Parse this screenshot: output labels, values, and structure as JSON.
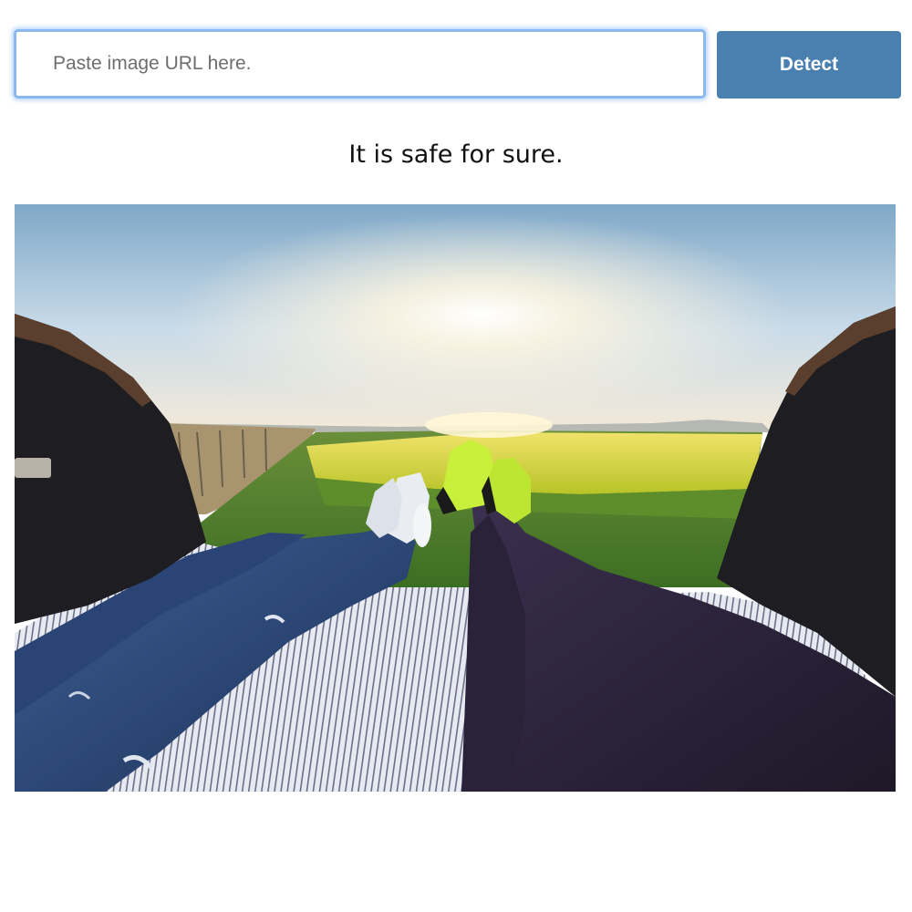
{
  "search": {
    "placeholder": "Paste image URL here.",
    "value": ""
  },
  "detect_button": {
    "label": "Detect"
  },
  "result": {
    "text": "It is safe for sure."
  },
  "photo": {
    "alt": "Two people lying in the open trunk of a car, feet up, facing a sunset over a green and yellow field",
    "colors": {
      "sky_top": "#7fa8c8",
      "sun": "#fff6e0",
      "field_yellow": "#e0e02a",
      "grass": "#4f8a2a",
      "sneaker_green": "#c8f03a",
      "jeans": "#2d4a7a",
      "dark_pants": "#2a2238",
      "car_interior": "#1d1d22"
    }
  },
  "colors": {
    "accent": "#4a80b0",
    "input_focus": "#8ab8ef"
  }
}
